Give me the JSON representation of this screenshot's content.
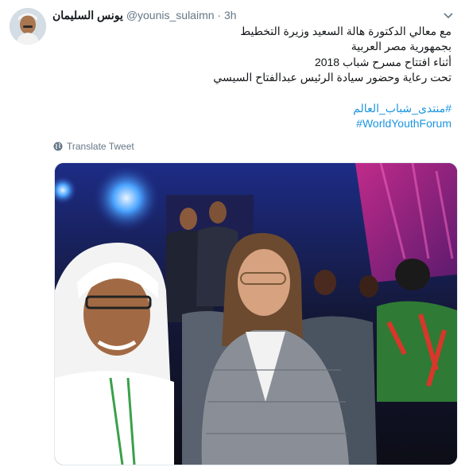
{
  "tweet": {
    "display_name": "يونس السليمان",
    "handle": "@younis_sulaimn",
    "separator": "·",
    "time": "3h",
    "text_lines": [
      "مع معالي الدكتورة هالة السعيد وزيرة التخطيط",
      "بجمهورية مصر العربية",
      "أثناء افتتاح مسرح شباب 2018",
      "تحت رعاية وحضور سيادة الرئيس عبدالفتاح السيسي"
    ],
    "hashtags": [
      "#منتدى_شباب_العالم",
      "#WorldYouthForum"
    ],
    "translate_label": "Translate Tweet"
  },
  "icons": {
    "chevron": "chevron-down-icon",
    "globe": "globe-icon"
  },
  "colors": {
    "link": "#1b95e0",
    "secondary_text": "#657786",
    "stage_pink": "#b0287a"
  }
}
